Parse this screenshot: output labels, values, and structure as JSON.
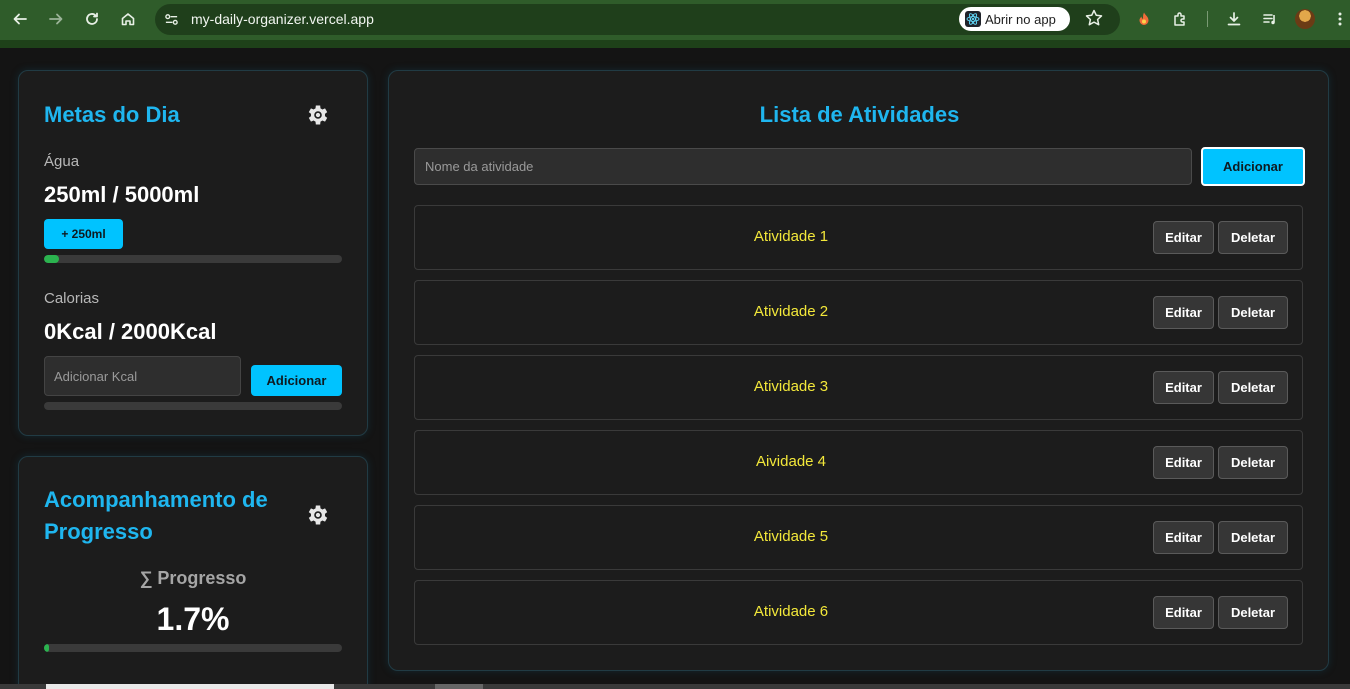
{
  "browser": {
    "url": "my-daily-organizer.vercel.app",
    "open_app_label": "Abrir no app"
  },
  "metas": {
    "title": "Metas do Dia",
    "agua_label": "Água",
    "agua_value": "250ml / 5000ml",
    "agua_button": "+ 250ml",
    "agua_progress_percent": 5,
    "calorias_label": "Calorias",
    "calorias_value": "0Kcal / 2000Kcal",
    "kcal_placeholder": "Adicionar Kcal",
    "kcal_button": "Adicionar",
    "calorias_progress_percent": 0
  },
  "progresso": {
    "title": "Acompanhamento de Progresso",
    "label": "∑ Progresso",
    "value": "1.7%",
    "progress_percent": 1.7
  },
  "atividades": {
    "title": "Lista de Atividades",
    "input_placeholder": "Nome da atividade",
    "add_button": "Adicionar",
    "edit_label": "Editar",
    "delete_label": "Deletar",
    "items": [
      {
        "name": "Atividade 1"
      },
      {
        "name": "Atividade 2"
      },
      {
        "name": "Atividade 3"
      },
      {
        "name": "Aividade 4"
      },
      {
        "name": "Atividade 5"
      },
      {
        "name": "Atividade 6"
      }
    ]
  },
  "colors": {
    "accent": "#1fb6ef",
    "button": "#00c3ff",
    "activity_text": "#f3e83a",
    "progress": "#2bb34f"
  }
}
